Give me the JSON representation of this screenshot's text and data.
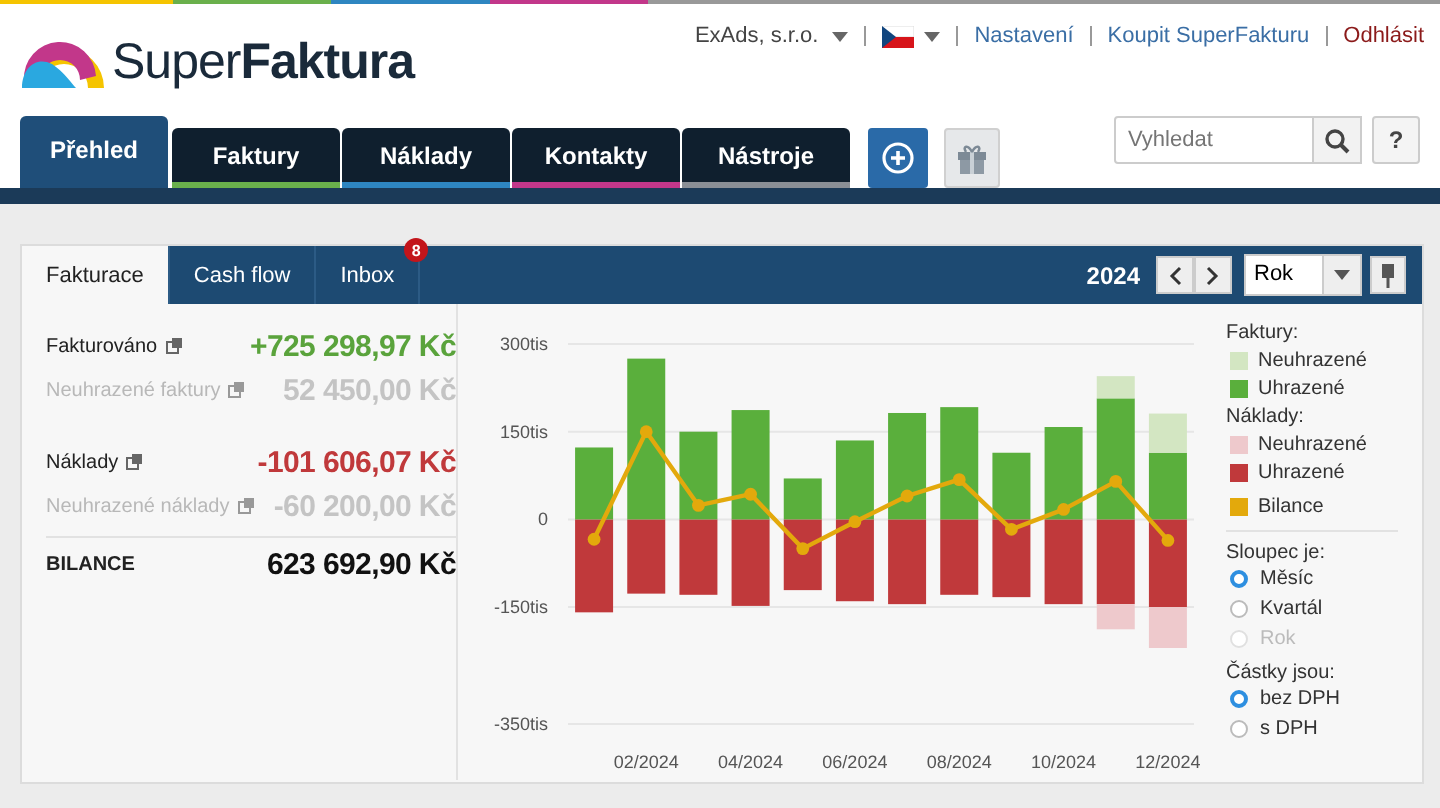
{
  "logo": {
    "text": "Super**Faktura**"
  },
  "top_links": [
    {
      "label": "ExAds, s.r.o.",
      "kind": "account"
    },
    {
      "kind": "language"
    },
    {
      "label": "Nastavení",
      "kind": "link"
    },
    {
      "label": "Koupit SuperFakturu",
      "kind": "link"
    },
    {
      "label": "Odhlásit",
      "kind": "logout"
    }
  ],
  "nav": [
    {
      "label": "Přehled",
      "selected": true,
      "color": "#1f4e79"
    },
    {
      "label": "Faktury",
      "selected": false,
      "color": "#6ab04c"
    },
    {
      "label": "Náklady",
      "selected": false,
      "color": "#2e86c1"
    },
    {
      "label": "Kontakty",
      "selected": false,
      "color": "#c2378a"
    },
    {
      "label": "Nástroje",
      "selected": false,
      "color": "#8a8f96"
    }
  ],
  "search": {
    "placeholder": "Vyhledat"
  },
  "help_button": "?",
  "card_tabs": [
    {
      "label": "Fakturace",
      "selected": true
    },
    {
      "label": "Cash flow",
      "selected": false
    },
    {
      "label": "Inbox",
      "selected": false,
      "badge": "8"
    }
  ],
  "period": {
    "year": "2024",
    "select": "Rok"
  },
  "stats": [
    {
      "label": "Fakturováno",
      "value": "+725 298,97 Kč",
      "kind": "positive",
      "link": true
    },
    {
      "label": "Neuhrazené faktury",
      "value": "52 450,00 Kč",
      "kind": "muted",
      "link": true
    },
    {
      "label": "Náklady",
      "value": "-101 606,07 Kč",
      "kind": "negative",
      "link": true
    },
    {
      "label": "Neuhrazené náklady",
      "value": "-60 200,00 Kč",
      "kind": "muted",
      "link": true
    },
    {
      "label": "BILANCE",
      "value": "623 692,90 Kč",
      "kind": "total",
      "link": false
    }
  ],
  "chart_data": {
    "type": "bar",
    "stacked": true,
    "categories": [
      null,
      "02/2024",
      null,
      "04/2024",
      null,
      "06/2024",
      null,
      "08/2024",
      null,
      "10/2024",
      null,
      "12/2024"
    ],
    "series": [
      {
        "name": "Neuhrazené",
        "color": "#d3e6c2",
        "values": [
          0,
          0,
          0,
          0,
          0,
          0,
          0,
          0,
          0,
          0,
          38,
          67
        ]
      },
      {
        "name": "Uhrazené",
        "color": "#5aaf3c",
        "values": [
          123,
          275,
          150,
          187,
          70,
          135,
          182,
          192,
          114,
          158,
          207,
          114
        ]
      },
      {
        "name": "Neuhrazené",
        "color": "#eec9cc",
        "values": [
          0,
          0,
          0,
          0,
          0,
          0,
          0,
          0,
          0,
          0,
          -43,
          -70
        ]
      },
      {
        "name": "Uhrazené",
        "color": "#c0393b",
        "values": [
          -159,
          -127,
          -129,
          -148,
          -121,
          -140,
          -145,
          -129,
          -133,
          -145,
          -145,
          -150
        ]
      },
      {
        "name": "Bilance",
        "color": "#e3a90c",
        "type": "line",
        "marker": true,
        "values": [
          -34,
          150,
          24,
          43,
          -50,
          -4,
          40,
          68,
          -17,
          17,
          65,
          -36
        ]
      }
    ],
    "grid": true,
    "ylim": [
      -350,
      300
    ],
    "yticks": [
      {
        "value": 300,
        "label": "300tis"
      },
      {
        "value": 150,
        "label": "150tis"
      },
      {
        "value": 0,
        "label": "0"
      },
      {
        "value": -150,
        "label": "-150tis"
      },
      {
        "value": -350,
        "label": "-350tis"
      }
    ]
  },
  "legend_headings": [
    "Faktury:",
    "Náklady:"
  ],
  "options": [
    {
      "heading": "Sloupec je:",
      "choices": [
        {
          "label": "Měsíc",
          "selected": true,
          "disabled": false
        },
        {
          "label": "Kvartál",
          "selected": false,
          "disabled": false
        },
        {
          "label": "Rok",
          "selected": false,
          "disabled": true
        }
      ]
    },
    {
      "heading": "Částky jsou:",
      "choices": [
        {
          "label": "bez DPH",
          "selected": true,
          "disabled": false
        },
        {
          "label": "s DPH",
          "selected": false,
          "disabled": false
        }
      ]
    }
  ]
}
